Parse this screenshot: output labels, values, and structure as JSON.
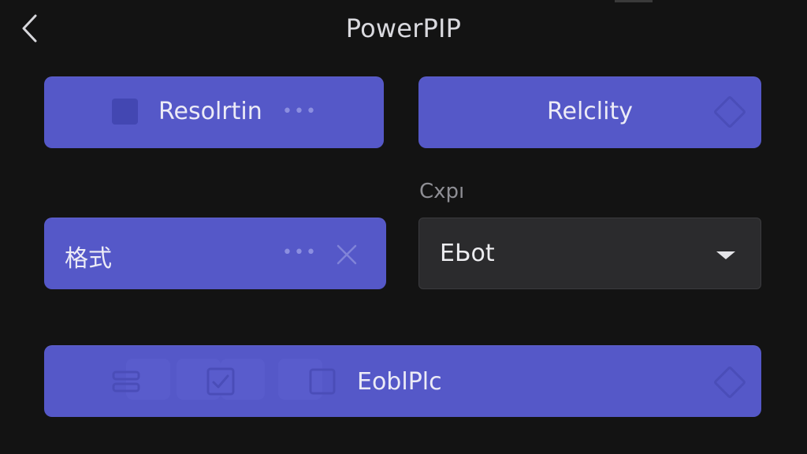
{
  "header": {
    "title": "PowerPIP",
    "back_icon": "chevron-left-icon"
  },
  "cards": {
    "resolution": {
      "label": "Resolrtin",
      "icon": "square-icon",
      "more_icon": "more-dots-icon"
    },
    "relclity": {
      "label": "Relclity",
      "icon": "diamond-icon"
    },
    "format": {
      "label": "格式",
      "more_icon": "more-dots-icon",
      "close_icon": "close-icon"
    },
    "enable": {
      "label": "EoblPlc",
      "icons": [
        "list-icon",
        "checkbox-icon",
        "square-outline-icon",
        "diamond-icon"
      ]
    }
  },
  "export": {
    "label": "Cxpı",
    "select_value": "EЬot"
  },
  "colors": {
    "background": "#131313",
    "card": "#5558c8",
    "select_bg": "#2b2b2d",
    "text": "#ecebf6"
  }
}
